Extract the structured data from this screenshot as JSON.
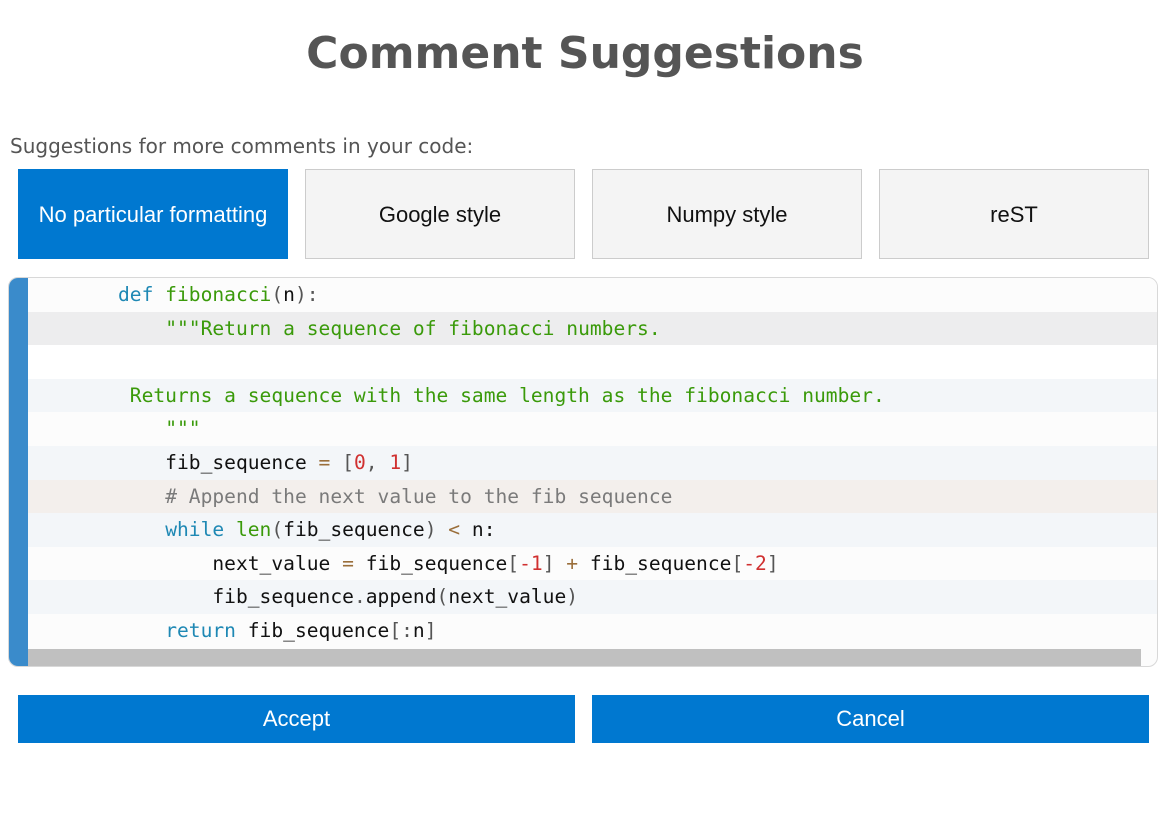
{
  "title": "Comment Suggestions",
  "subtitle": "Suggestions for more comments in your code:",
  "formats": [
    {
      "label": "No particular formatting",
      "active": true
    },
    {
      "label": "Google style",
      "active": false
    },
    {
      "label": "Numpy style",
      "active": false
    },
    {
      "label": "reST",
      "active": false
    }
  ],
  "code": {
    "lines": [
      {
        "bg": "#fcfcfc",
        "tokens": [
          [
            "kw",
            "def"
          ],
          [
            "",
            ""
          ],
          [
            "fn",
            " fibonacci"
          ],
          [
            "pn",
            "("
          ],
          [
            "",
            "n"
          ],
          [
            "pn",
            "):"
          ]
        ]
      },
      {
        "bg": "#ededee",
        "tokens": [
          [
            "",
            "    "
          ],
          [
            "str",
            "\"\"\"Return a sequence of fibonacci numbers."
          ]
        ]
      },
      {
        "bg": "#ffffff",
        "tokens": []
      },
      {
        "bg": "#f3f6f9",
        "tokens": [
          [
            "str",
            " Returns a sequence with the same length as the fibonacci number."
          ]
        ]
      },
      {
        "bg": "#fcfcfc",
        "tokens": [
          [
            "",
            "    "
          ],
          [
            "str",
            "\"\"\""
          ]
        ]
      },
      {
        "bg": "#f3f6f9",
        "tokens": [
          [
            "",
            "    fib_sequence "
          ],
          [
            "op",
            "="
          ],
          [
            "pn",
            " ["
          ],
          [
            "num",
            "0"
          ],
          [
            "pn",
            ", "
          ],
          [
            "num",
            "1"
          ],
          [
            "pn",
            "]"
          ]
        ]
      },
      {
        "bg": "#f3efec",
        "tokens": [
          [
            "",
            "    "
          ],
          [
            "cm",
            "# Append the next value to the fib sequence"
          ]
        ]
      },
      {
        "bg": "#f3f6f9",
        "tokens": [
          [
            "",
            "    "
          ],
          [
            "kw",
            "while"
          ],
          [
            "",
            " "
          ],
          [
            "fn",
            "len"
          ],
          [
            "pn",
            "("
          ],
          [
            "",
            "fib_sequence"
          ],
          [
            "pn",
            ")"
          ],
          [
            "op",
            " <"
          ],
          [
            "",
            " n:"
          ]
        ]
      },
      {
        "bg": "#fcfcfc",
        "tokens": [
          [
            "",
            "        next_value "
          ],
          [
            "op",
            "="
          ],
          [
            "",
            " fib_sequence"
          ],
          [
            "pn",
            "["
          ],
          [
            "num",
            "-1"
          ],
          [
            "pn",
            "]"
          ],
          [
            "op",
            " +"
          ],
          [
            "",
            " fib_sequence"
          ],
          [
            "pn",
            "["
          ],
          [
            "num",
            "-2"
          ],
          [
            "pn",
            "]"
          ]
        ]
      },
      {
        "bg": "#f3f6f9",
        "tokens": [
          [
            "",
            "        fib_sequence"
          ],
          [
            "pn",
            "."
          ],
          [
            "",
            "append"
          ],
          [
            "pn",
            "("
          ],
          [
            "",
            "next_value"
          ],
          [
            "pn",
            ")"
          ]
        ]
      },
      {
        "bg": "#fcfcfc",
        "tokens": [
          [
            "",
            "    "
          ],
          [
            "kw",
            "return"
          ],
          [
            "",
            " fib_sequence"
          ],
          [
            "pn",
            "[:"
          ],
          [
            "",
            "n"
          ],
          [
            "pn",
            "]"
          ]
        ]
      }
    ]
  },
  "actions": {
    "accept": "Accept",
    "cancel": "Cancel"
  }
}
